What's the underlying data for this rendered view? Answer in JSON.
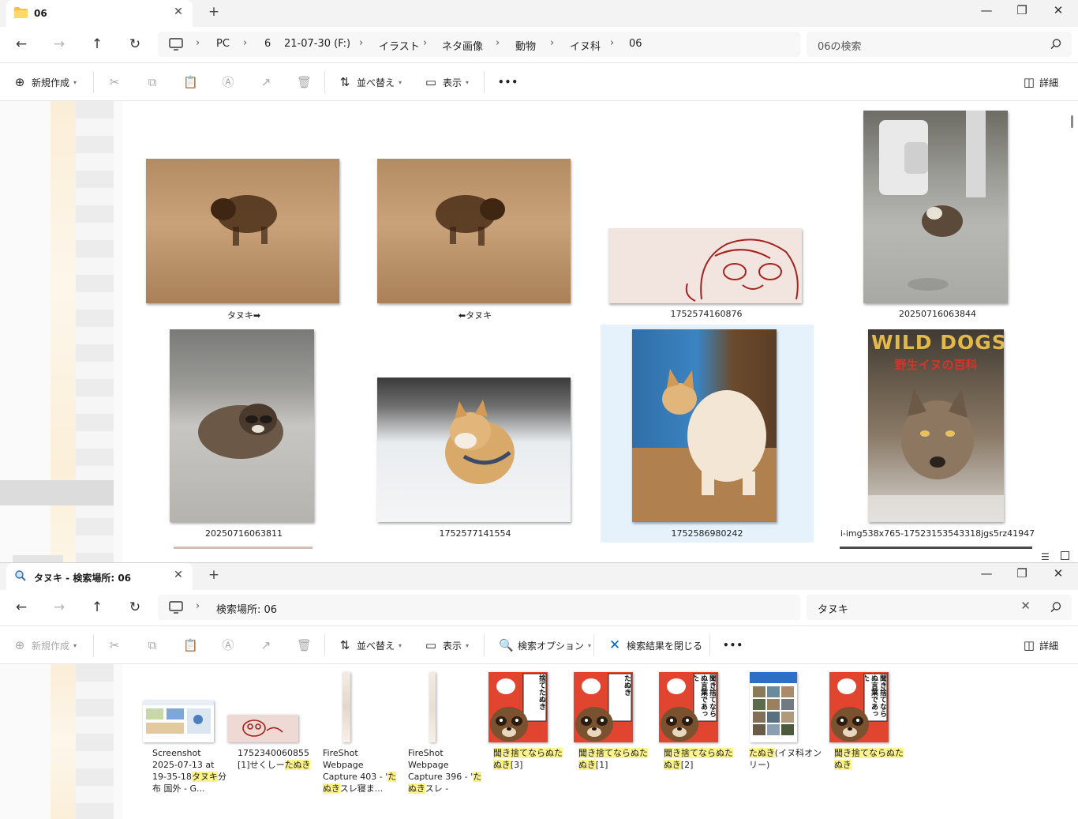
{
  "window1": {
    "tab_title": "06",
    "tab_close": "✕",
    "new_tab": "+",
    "controls": {
      "minimize": "—",
      "maximize": "❐",
      "close": "✕"
    },
    "nav": {
      "back": "←",
      "forward": "→",
      "up": "↑",
      "refresh": "↻"
    },
    "breadcrumb": [
      "PC",
      "6",
      "21-07-30 (F:)",
      "イラスト",
      "ネタ画像",
      "動物",
      "イヌ科",
      "06"
    ],
    "search_placeholder": "06の検索",
    "toolbar": {
      "new": "新規作成",
      "sort": "並べ替え",
      "view": "表示",
      "more": "•••",
      "details": "詳細"
    },
    "files": [
      {
        "name": "タヌキ➡",
        "icon": "raccoon-dog-running-photo"
      },
      {
        "name": "⬅タヌキ",
        "icon": "raccoon-dog-running-photo"
      },
      {
        "name": "1752574160876",
        "icon": "raccoon-sketch-banner"
      },
      {
        "name": "20250716063844",
        "icon": "raccoon-dog-street-photo"
      },
      {
        "name": "20250716063811",
        "icon": "raccoon-dog-sitting-photo"
      },
      {
        "name": "1752577141554",
        "icon": "shiba-snow-photo"
      },
      {
        "name": "1752586980242",
        "icon": "corgi-photo"
      },
      {
        "name": "i-img538x765-17523153543318jgs5rz41947",
        "icon": "wild-dogs-book-cover"
      }
    ],
    "book_cover": {
      "title": "WILD DOGS",
      "subtitle": "野生イヌの百科"
    }
  },
  "window2": {
    "tab_title": "タヌキ - 検索場所: 06",
    "tab_close": "✕",
    "new_tab": "+",
    "controls": {
      "minimize": "—",
      "maximize": "❐",
      "close": "✕"
    },
    "nav": {
      "back": "←",
      "forward": "→",
      "up": "↑",
      "refresh": "↻"
    },
    "location": "検索場所: 06",
    "search_value": "タヌキ",
    "search_clear": "✕",
    "toolbar": {
      "new": "新規作成",
      "sort": "並べ替え",
      "view": "表示",
      "search_options": "検索オプション",
      "close_search": "検索結果を閉じる",
      "more": "•••",
      "details": "詳細"
    },
    "results": [
      {
        "parts": [
          [
            "Screenshot 2025-07-13 at 19-35-18",
            false
          ],
          [
            "タヌキ",
            true
          ],
          [
            "分布 国外 - G...",
            false
          ]
        ],
        "icon": "screenshot-thumb"
      },
      {
        "parts": [
          [
            "1752340060855 [1]せくしー",
            false
          ],
          [
            "たぬき",
            true
          ]
        ],
        "icon": "sketch-thumb"
      },
      {
        "parts": [
          [
            "FireShot Webpage Capture 403 - '",
            false
          ],
          [
            "たぬき",
            true
          ],
          [
            "スレ寝ま...",
            false
          ]
        ],
        "icon": "tall-capture-thumb"
      },
      {
        "parts": [
          [
            "FireShot Webpage Capture 396 - '",
            false
          ],
          [
            "たぬき",
            true
          ],
          [
            "スレ -",
            false
          ]
        ],
        "icon": "tall-capture-thumb"
      },
      {
        "parts": [
          [
            "聞き捨てならぬた",
            true
          ],
          [
            "ぬき",
            true
          ],
          [
            "[3]",
            false
          ]
        ],
        "icon": "tanuki-manga-thumb",
        "sign": "捨てたぬき"
      },
      {
        "parts": [
          [
            "聞き捨てならぬた",
            true
          ],
          [
            "ぬき",
            true
          ],
          [
            "[1]",
            false
          ]
        ],
        "icon": "tanuki-manga-thumb",
        "sign": "たぬき"
      },
      {
        "parts": [
          [
            "聞き捨てならぬた",
            true
          ],
          [
            "ぬき",
            true
          ],
          [
            "[2]",
            false
          ]
        ],
        "icon": "tanuki-manga-thumb",
        "sign": "聞き捨てならぬ言葉であった"
      },
      {
        "parts": [
          [
            "たぬき",
            true
          ],
          [
            "(イヌ科オンリー)",
            false
          ]
        ],
        "icon": "grid-page-thumb"
      },
      {
        "parts": [
          [
            "聞き捨てならぬた",
            true
          ],
          [
            "ぬき",
            true
          ]
        ],
        "icon": "tanuki-manga-thumb",
        "sign": "聞き捨てならぬ言葉であった"
      }
    ]
  },
  "colors": {
    "selected": "#e5f1fb",
    "highlight": "#fff48a",
    "folder": "#f4c145",
    "accent": "#0067c0"
  }
}
